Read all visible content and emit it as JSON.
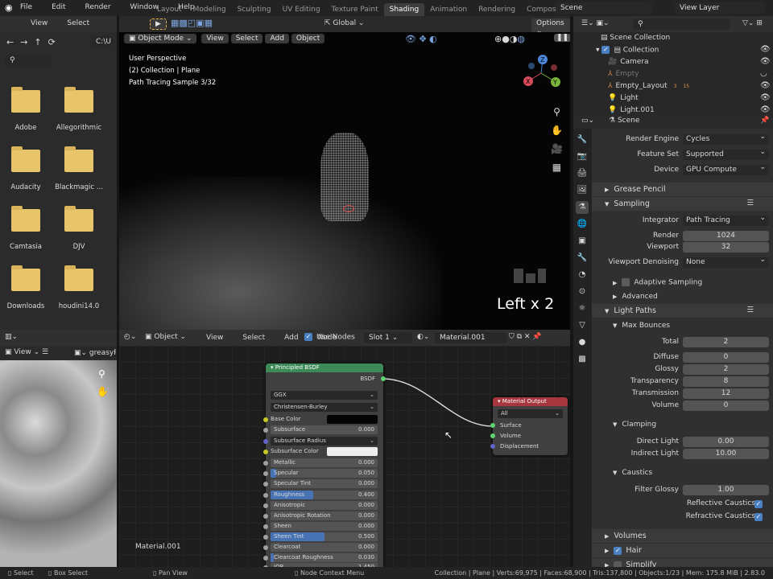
{
  "topbar": {
    "menus": [
      "File",
      "Edit",
      "Render",
      "Window",
      "Help"
    ],
    "workspaces": [
      "Layout",
      "Modeling",
      "Sculpting",
      "UV Editing",
      "Texture Paint",
      "Shading",
      "Animation",
      "Rendering",
      "Compositing"
    ],
    "active_workspace": "Shading",
    "scene": "Scene",
    "view_layer": "View Layer"
  },
  "file_browser": {
    "menus": [
      "View",
      "Select"
    ],
    "path": "C:\\U",
    "folders": [
      "Adobe",
      "Allegorithmic",
      "Audacity",
      "Blackmagic ...",
      "Camtasia",
      "DJV",
      "Downloads",
      "houdini14.0"
    ]
  },
  "viewport": {
    "tool_header": {
      "orientation": "Global",
      "options": "Options"
    },
    "mode": "Object Mode",
    "menus": [
      "View",
      "Select",
      "Add",
      "Object"
    ],
    "overlay_lines": [
      "User Perspective",
      "(2) Collection | Plane",
      "Path Tracing Sample 3/32"
    ],
    "key_hint": "Left x 2",
    "gizmo": {
      "x": "X",
      "y": "Y",
      "z": "Z"
    }
  },
  "outliner": {
    "root": "Scene Collection",
    "collection": "Collection",
    "items": [
      {
        "name": "Camera",
        "icon": "camera-icon"
      },
      {
        "name": "Empty",
        "icon": "empty-icon",
        "dim": true
      },
      {
        "name": "Empty_Layout",
        "icon": "empty-icon",
        "badges": [
          "3",
          "15"
        ]
      },
      {
        "name": "Light",
        "icon": "light-icon"
      },
      {
        "name": "Light.001",
        "icon": "light-icon"
      }
    ]
  },
  "properties": {
    "context": "Scene",
    "rows": [
      {
        "t": "dd",
        "label": "Render Engine",
        "value": "Cycles"
      },
      {
        "t": "dd",
        "label": "Feature Set",
        "value": "Supported"
      },
      {
        "t": "dd",
        "label": "Device",
        "value": "GPU Compute"
      },
      {
        "t": "head",
        "label": "Grease Pencil",
        "open": false
      },
      {
        "t": "head",
        "label": "Sampling",
        "open": true
      },
      {
        "t": "dd",
        "label": "Integrator",
        "value": "Path Tracing"
      },
      {
        "t": "num",
        "label": "Render",
        "value": "1024"
      },
      {
        "t": "num",
        "label": "Viewport",
        "value": "32"
      },
      {
        "t": "dd",
        "label": "Viewport Denoising",
        "value": "None"
      },
      {
        "t": "sub",
        "label": "Adaptive Sampling",
        "open": false,
        "check": false
      },
      {
        "t": "sub",
        "label": "Advanced",
        "open": false
      },
      {
        "t": "head",
        "label": "Light Paths",
        "open": true
      },
      {
        "t": "sub",
        "label": "Max Bounces",
        "open": true
      },
      {
        "t": "num",
        "label": "Total",
        "value": "2"
      },
      {
        "t": "num",
        "label": "Diffuse",
        "value": "0"
      },
      {
        "t": "num",
        "label": "Glossy",
        "value": "2"
      },
      {
        "t": "num",
        "label": "Transparency",
        "value": "8"
      },
      {
        "t": "num",
        "label": "Transmission",
        "value": "12"
      },
      {
        "t": "num",
        "label": "Volume",
        "value": "0"
      },
      {
        "t": "sub",
        "label": "Clamping",
        "open": true
      },
      {
        "t": "num",
        "label": "Direct Light",
        "value": "0.00"
      },
      {
        "t": "num",
        "label": "Indirect Light",
        "value": "10.00"
      },
      {
        "t": "sub",
        "label": "Caustics",
        "open": true
      },
      {
        "t": "num",
        "label": "Filter Glossy",
        "value": "1.00"
      },
      {
        "t": "check",
        "label": "Reflective Caustics",
        "value": true
      },
      {
        "t": "check",
        "label": "Refractive Caustics",
        "value": true
      },
      {
        "t": "head",
        "label": "Volumes",
        "open": false
      },
      {
        "t": "head",
        "label": "Hair",
        "open": false,
        "check": true
      },
      {
        "t": "head",
        "label": "Simplify",
        "open": false,
        "check": false
      }
    ]
  },
  "image_editor": {
    "view": "View",
    "image": "greasyPl"
  },
  "node_editor": {
    "object": "Object",
    "menus": [
      "View",
      "Select",
      "Add",
      "Node"
    ],
    "use_nodes": "Use Nodes",
    "slot": "Slot 1",
    "material": "Material.001",
    "label": "Material.001",
    "bsdf": {
      "title": "Principled BSDF",
      "output": "BSDF",
      "distribution": "GGX",
      "subsurface_method": "Christensen-Burley",
      "base_color_label": "Base Color",
      "subsurface_radius": "Subsurface Radius",
      "subsurface_color_label": "Subsurface Color",
      "inputs": [
        {
          "label": "Subsurface",
          "value": "0.000",
          "fill": 0
        },
        {
          "label": "Metallic",
          "value": "0.000",
          "fill": 0
        },
        {
          "label": "Specular",
          "value": "0.050",
          "fill": 0.05
        },
        {
          "label": "Specular Tint",
          "value": "0.000",
          "fill": 0
        },
        {
          "label": "Roughness",
          "value": "0.400",
          "fill": 0.4
        },
        {
          "label": "Anisotropic",
          "value": "0.000",
          "fill": 0
        },
        {
          "label": "Anisotropic Rotation",
          "value": "0.000",
          "fill": 0
        },
        {
          "label": "Sheen",
          "value": "0.000",
          "fill": 0
        },
        {
          "label": "Sheen Tint",
          "value": "0.500",
          "fill": 0.5
        },
        {
          "label": "Clearcoat",
          "value": "0.000",
          "fill": 0
        },
        {
          "label": "Clearcoat Roughness",
          "value": "0.030",
          "fill": 0.03
        },
        {
          "label": "IOR",
          "value": "1.450",
          "fill": 0
        }
      ]
    },
    "output": {
      "title": "Material Output",
      "target": "All",
      "sockets": [
        "Surface",
        "Volume",
        "Displacement"
      ]
    }
  },
  "statusbar": {
    "hints": [
      "Select",
      "Box Select",
      "Pan View",
      "Node Context Menu"
    ],
    "info": "Collection | Plane | Verts:69,975 | Faces:68,900 | Tris:137,800 | Objects:1/23 | Mem: 175.8 MiB | 2.83.0"
  },
  "colors": {
    "accent": "#4a7fc2",
    "bsdf_header": "#3b8a57",
    "output_header": "#a8363f",
    "folder": "#e8c56b"
  }
}
